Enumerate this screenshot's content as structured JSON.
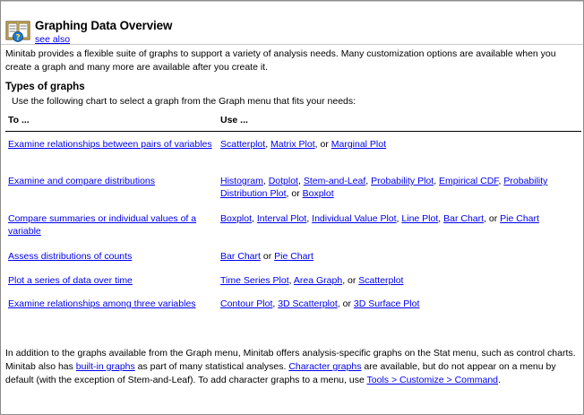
{
  "header": {
    "title": "Graphing Data Overview",
    "see_also": "see also"
  },
  "intro": "Minitab provides a flexible suite of graphs to support a variety of analysis needs. Many customization options are available when you create a graph and many more are available after you create it.",
  "types_heading": "Types of graphs",
  "use_text": "Use the following chart to select a graph from the Graph menu that fits your needs:",
  "table": {
    "col_to": "To ...",
    "col_use": "Use ...",
    "rows": [
      {
        "to": "Examine relationships between pairs of variables",
        "use": [
          {
            "text": "Scatterplot",
            "link": true
          },
          {
            "text": ", ",
            "link": false
          },
          {
            "text": "Matrix Plot",
            "link": true
          },
          {
            "text": ", or ",
            "link": false
          },
          {
            "text": "Marginal Plot",
            "link": true
          }
        ]
      },
      {
        "to": "Examine and compare distributions",
        "use": [
          {
            "text": "Histogram",
            "link": true
          },
          {
            "text": ", ",
            "link": false
          },
          {
            "text": "Dotplot",
            "link": true
          },
          {
            "text": ", ",
            "link": false
          },
          {
            "text": "Stem-and-Leaf",
            "link": true
          },
          {
            "text": ", ",
            "link": false
          },
          {
            "text": "Probability Plot",
            "link": true
          },
          {
            "text": ", ",
            "link": false
          },
          {
            "text": "Empirical CDF",
            "link": true
          },
          {
            "text": ", ",
            "link": false
          },
          {
            "text": "Probability Distribution Plot",
            "link": true
          },
          {
            "text": ", or ",
            "link": false
          },
          {
            "text": "Boxplot",
            "link": true
          }
        ]
      },
      {
        "to": "Compare summaries or individual values of a variable",
        "use": [
          {
            "text": "Boxplot",
            "link": true
          },
          {
            "text": ", ",
            "link": false
          },
          {
            "text": "Interval Plot",
            "link": true
          },
          {
            "text": ", ",
            "link": false
          },
          {
            "text": "Individual Value Plot",
            "link": true
          },
          {
            "text": ", ",
            "link": false
          },
          {
            "text": "Line Plot",
            "link": true
          },
          {
            "text": ",  ",
            "link": false
          },
          {
            "text": "Bar Chart",
            "link": true
          },
          {
            "text": ", or ",
            "link": false
          },
          {
            "text": "Pie Chart",
            "link": true
          }
        ]
      },
      {
        "to": "Assess distributions of counts",
        "use": [
          {
            "text": "Bar Chart",
            "link": true
          },
          {
            "text": " or ",
            "link": false
          },
          {
            "text": "Pie Chart",
            "link": true
          }
        ]
      },
      {
        "to": "Plot a series of data over time",
        "use": [
          {
            "text": "Time Series Plot",
            "link": true
          },
          {
            "text": ", ",
            "link": false
          },
          {
            "text": "Area Graph",
            "link": true
          },
          {
            "text": ", or ",
            "link": false
          },
          {
            "text": "Scatterplot",
            "link": true
          }
        ]
      },
      {
        "to": "Examine relationships among three variables",
        "use": [
          {
            "text": "Contour Plot",
            "link": true
          },
          {
            "text": ", ",
            "link": false
          },
          {
            "text": "3D Scatterplot",
            "link": true
          },
          {
            "text": ", or ",
            "link": false
          },
          {
            "text": "3D Surface Plot",
            "link": true
          }
        ]
      }
    ]
  },
  "footer": [
    {
      "text": "In addition to the graphs available from the Graph menu, Minitab offers analysis-specific graphs on the Stat menu, such as control charts. Minitab also has ",
      "link": false
    },
    {
      "text": "built-in graphs",
      "link": true
    },
    {
      "text": " as part of many statistical analyses. ",
      "link": false
    },
    {
      "text": "Character graphs",
      "link": true
    },
    {
      "text": " are available, but do not appear on a menu by default (with the exception of Stem-and-Leaf). To add character graphs to a menu, use ",
      "link": false
    },
    {
      "text": "Tools > Customize > Command",
      "link": true
    },
    {
      "text": ".",
      "link": false
    }
  ]
}
